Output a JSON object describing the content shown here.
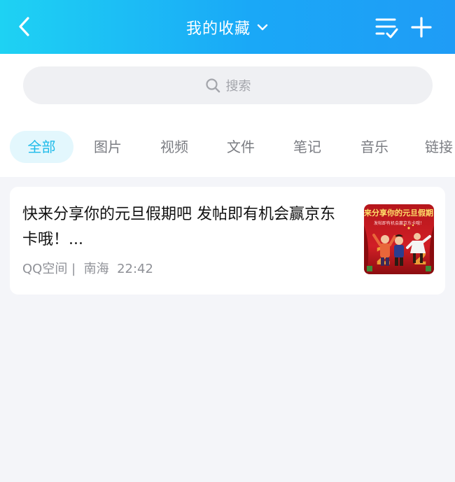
{
  "header": {
    "title": "我的收藏",
    "back_icon": "chevron-left-icon",
    "dropdown_icon": "chevron-down-icon",
    "manage_icon": "list-check-icon",
    "add_icon": "plus-icon",
    "gradient_start": "#1ed2f3",
    "gradient_end": "#1f9cf6"
  },
  "search": {
    "placeholder": "搜索",
    "icon": "search-icon"
  },
  "tabs": [
    {
      "label": "全部",
      "active": true
    },
    {
      "label": "图片",
      "active": false
    },
    {
      "label": "视频",
      "active": false
    },
    {
      "label": "文件",
      "active": false
    },
    {
      "label": "笔记",
      "active": false
    },
    {
      "label": "音乐",
      "active": false
    },
    {
      "label": "链接",
      "active": false
    }
  ],
  "items": [
    {
      "title": "快来分享你的元旦假期吧 发帖即有机会赢京东卡哦！...",
      "source": "QQ空间",
      "separator": "|",
      "author": "南海",
      "time": "22:42",
      "thumbnail": {
        "headline": "来分享你的元旦假期",
        "subline": "发帖即有机会赢京东卡哦！"
      }
    }
  ],
  "colors": {
    "accent": "#1fbbe9",
    "active_tab_bg": "#e3f7fd",
    "page_bg": "#f4f5f9"
  }
}
